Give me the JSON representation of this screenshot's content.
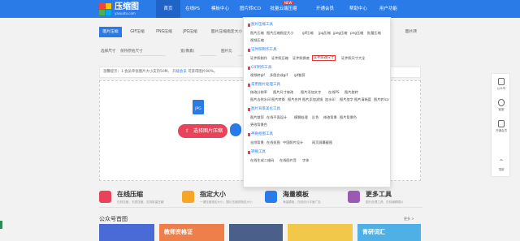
{
  "brand": {
    "name": "压缩图",
    "domain": "yasuotu.com"
  },
  "nav": {
    "items": [
      "首页",
      "在线PS",
      "模板中心",
      "图片转ICO",
      "批量云端压缩",
      "开通会员",
      "帮助中心",
      "用户功能"
    ],
    "hot_badge": "NEW"
  },
  "tabs": [
    "图片压缩",
    "GIF压缩",
    "PNG压缩",
    "JPG压缩",
    "图片压缩指定大小",
    "",
    "",
    "",
    "",
    "图片转"
  ],
  "toolbar": {
    "size_label": "选择尺寸",
    "size_value": "保持原始尺寸",
    "width_label": "宽(像素)",
    "height_label": "图片比"
  },
  "notice": {
    "text": "温馨提示：1.会员单张图片大小支持50M。",
    "link": "升级会员",
    "text2": "可获得图片80%。"
  },
  "upload": {
    "button": "选择图片压缩",
    "jpg_label": "JPG"
  },
  "menu": {
    "sections": [
      {
        "title": "图片压缩工具",
        "items": [
          "图片压缩",
          "图片压缩指定大小",
          "gif压缩",
          "jpg压缩",
          "jpeg压缩",
          "png压缩",
          "批量压缩",
          "视频压缩"
        ]
      },
      {
        "title": "证件照制作工具",
        "items": [
          "证件照制作",
          "证件照压缩",
          "证件照换底",
          "证件照改尺寸",
          "证件照尺寸大全"
        ]
      },
      {
        "title": "GIF制作工具",
        "items": [
          "视频转gif",
          "多图合成gif",
          "gif裁剪"
        ]
      },
      {
        "title": "常用图片处理工具",
        "items": [
          "修改分辨率",
          "图片尺寸修改",
          "图片添加文字",
          "在线PS",
          "图片旋转",
          "图片去除水印",
          "图片转换",
          "图片合并",
          "图片添加滤镜",
          "加水印",
          "图片加字",
          "图片清晰度",
          "图片转ico"
        ]
      },
      {
        "title": "图片背景美化工具",
        "items": [
          "图片裁剪",
          "在线平面设计",
          "模糊处理",
          "反色",
          "修改背景",
          "图片背景色",
          "更改背景色"
        ]
      },
      {
        "title": "神奇抠图工具",
        "items": [
          "去除背景",
          "在线抠图",
          "中国照片设计",
          "网页屏幕截图"
        ]
      },
      {
        "title": "转换工具",
        "items": [
          "在线生成二维码",
          "在线图片音",
          "字体"
        ]
      }
    ]
  },
  "sidebar": {
    "items": [
      "公众号",
      "客服",
      "开通会员",
      "顶部"
    ]
  },
  "features": [
    {
      "title": "在线压缩",
      "desc": "在线压缩，无损压缩，支持批量压缩",
      "color": "#e8435a"
    },
    {
      "title": "指定大小",
      "desc": "一键压缩指定大小，图片压缩到指定大小",
      "color": "#f6a623"
    },
    {
      "title": "海量模板",
      "desc": "海量模板，在线设计平面广告",
      "color": "#2a7ae8"
    },
    {
      "title": "更多工具",
      "desc": "图片处理工具，在线编辑图片",
      "color": "#9b59b6"
    }
  ],
  "section": {
    "title": "公众号首图",
    "more": "更多 >"
  },
  "cards": [
    "",
    "教师资格证",
    "",
    "",
    "青研词汇"
  ],
  "colors": {
    "primary": "#2a7ae8",
    "accent": "#e8435a"
  }
}
